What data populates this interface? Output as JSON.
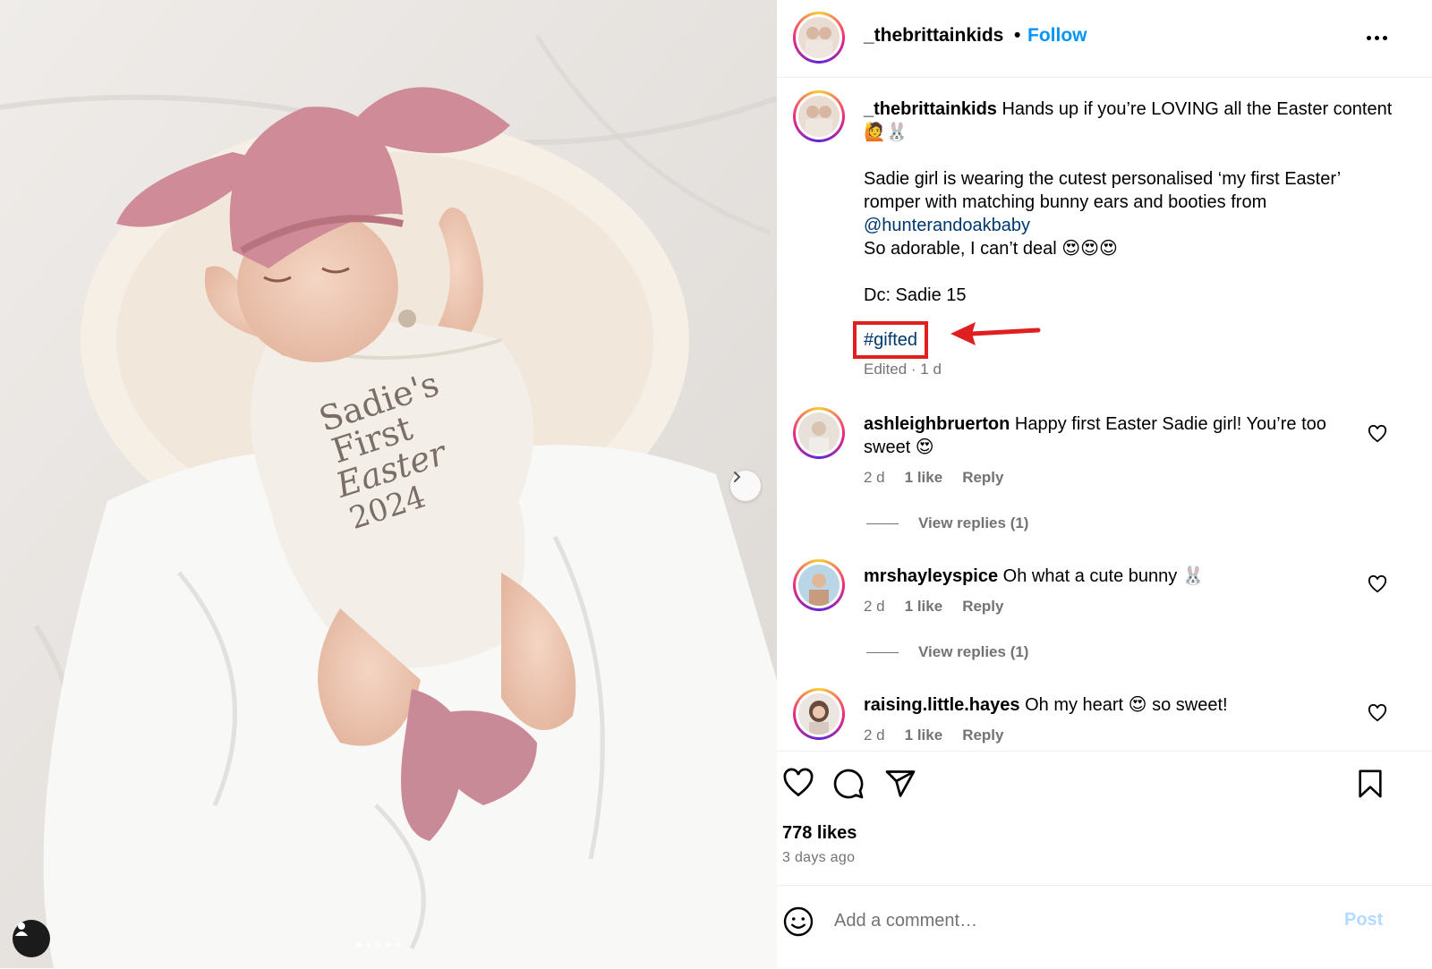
{
  "post": {
    "username": "_thebrittainkids",
    "separator": "•",
    "follow_label": "Follow",
    "carousel_dots": [
      true,
      false,
      false,
      false,
      false
    ]
  },
  "caption": {
    "username": "_thebrittainkids",
    "line1": "Hands up if you’re LOVING all the Easter content 🙋🐰",
    "line2": "Sadie girl is wearing the cutest personalised ‘my first Easter’ romper with matching bunny ears and booties from",
    "mention": "@hunterandoakbaby",
    "line3": "So adorable, I can’t deal 😍😍😍",
    "line4": "Dc: Sadie 15",
    "hashtag": "#gifted",
    "edited": "Edited · 1 d"
  },
  "comments": [
    {
      "username": "ashleighbruerton",
      "text": "Happy first Easter Sadie girl! You’re too sweet 😍",
      "time": "2 d",
      "likes": "1 like",
      "reply": "Reply",
      "view_replies": "View replies (1)"
    },
    {
      "username": "mrshayleyspice",
      "text": "Oh what a cute bunny 🐰",
      "time": "2 d",
      "likes": "1 like",
      "reply": "Reply",
      "view_replies": "View replies (1)"
    },
    {
      "username": "raising.little.hayes",
      "text": "Oh my heart 😍 so sweet!",
      "time": "2 d",
      "likes": "1 like",
      "reply": "Reply"
    }
  ],
  "stats": {
    "likes": "778 likes",
    "posted": "3 days ago"
  },
  "add_comment": {
    "placeholder": "Add a comment…",
    "post_label": "Post"
  },
  "colors": {
    "link": "#0095f6",
    "mention": "#00376b",
    "highlight": "#e02020",
    "muted": "#737373"
  },
  "icons": [
    "chevron-right-icon",
    "user-tag-icon",
    "more-icon",
    "heart-icon",
    "comment-icon",
    "share-icon",
    "bookmark-icon",
    "emoji-icon"
  ]
}
